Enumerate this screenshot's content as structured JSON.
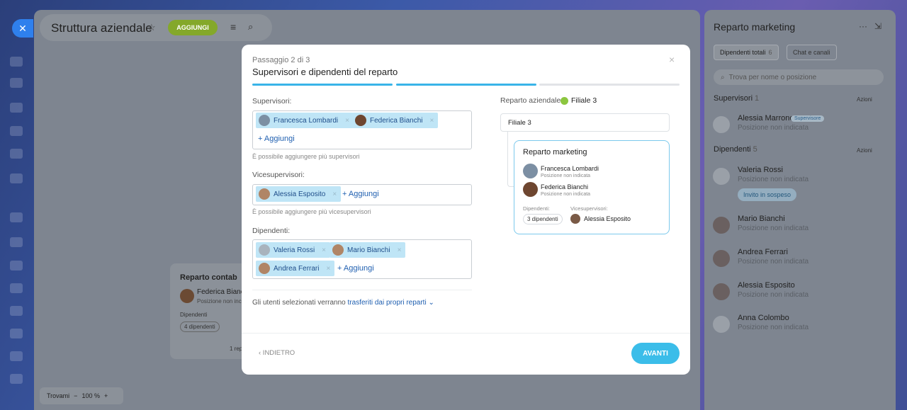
{
  "header": {
    "title": "Struttura aziendale",
    "add_label": "AGGIUNGI",
    "pin_icon": "pin-icon",
    "menu_icon": "hamburger-icon",
    "search_icon": "search-icon"
  },
  "background_card": {
    "title": "Reparto contab",
    "person_name": "Federica Bianc",
    "person_position": "Posizione non inc",
    "dept_label": "Dipendenti",
    "dept_count": "4 dipendenti",
    "footer": "1 rep"
  },
  "zoom": {
    "label": "Trovami",
    "minus": "−",
    "value": "100",
    "unit": "%",
    "plus": "+"
  },
  "modal": {
    "step": "Passaggio 2 di 3",
    "title": "Supervisori e dipendenti del reparto",
    "close": "×",
    "supervisors": {
      "label": "Supervisori:",
      "chips": [
        "Francesca Lombardi",
        "Federica Bianchi"
      ],
      "add": "+ Aggiungi",
      "hint": "È possibile aggiungere più supervisori"
    },
    "deputies": {
      "label": "Vicesupervisori:",
      "chips": [
        "Alessia Esposito"
      ],
      "add": "+ Aggiungi",
      "hint": "È possibile aggiungere più vicesupervisori"
    },
    "employees": {
      "label": "Dipendenti:",
      "chips": [
        "Valeria Rossi",
        "Mario Bianchi",
        "Andrea Ferrari"
      ],
      "add": "+ Aggiungi"
    },
    "transfer_text": "Gli utenti selezionati verranno",
    "transfer_link": "trasferiti dai propri reparti",
    "dept_label": "Reparto aziendale:",
    "dept_value": "Filiale 3",
    "tree": {
      "parent": "Filiale 3",
      "card_title": "Reparto marketing",
      "people": [
        {
          "name": "Francesca Lombardi",
          "position": "Posizione non indicata"
        },
        {
          "name": "Federica Bianchi",
          "position": "Posizione non indicata"
        }
      ],
      "employees_label": "Dipendenti:",
      "employees_count": "3 dipendenti",
      "deputies_label": "Vicesupervisori:",
      "deputy_name": "Alessia Esposito"
    },
    "back": "‹ INDIETRO",
    "next": "AVANTI"
  },
  "right_panel": {
    "title": "Reparto marketing",
    "tab_total": "Dipendenti totali",
    "tab_total_count": "6",
    "tab_chat": "Chat e canali",
    "search_placeholder": "Trova per nome o posizione",
    "supervisors_label": "Supervisori",
    "supervisors_count": "1",
    "actions": "Azioni",
    "supervisor": {
      "name": "Alessia Marrone",
      "badge": "Supervisore",
      "position": "Posizione non indicata"
    },
    "employees_label": "Dipendenti",
    "employees_count": "5",
    "invite": "Invito in sospeso",
    "employees": [
      {
        "name": "Valeria Rossi",
        "position": "Posizione non indicata"
      },
      {
        "name": "Mario Bianchi",
        "position": "Posizione non indicata"
      },
      {
        "name": "Andrea Ferrari",
        "position": "Posizione non indicata"
      },
      {
        "name": "Alessia Esposito",
        "position": "Posizione non indicata"
      },
      {
        "name": "Anna Colombo",
        "position": "Posizione non indicata"
      }
    ]
  }
}
